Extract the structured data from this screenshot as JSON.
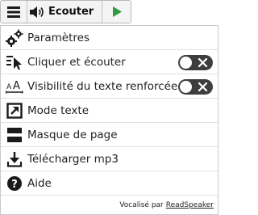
{
  "player": {
    "listen_label": "Ecouter"
  },
  "menu": {
    "items": [
      {
        "label": "Paramètres",
        "icon": "gears-icon"
      },
      {
        "label": "Cliquer et écouter",
        "icon": "click-listen-icon",
        "toggle": "off"
      },
      {
        "label": "Visibilité du texte renforcée",
        "icon": "text-size-icon",
        "toggle": "off"
      },
      {
        "label": "Mode texte",
        "icon": "text-mode-icon"
      },
      {
        "label": "Masque de page",
        "icon": "page-mask-icon"
      },
      {
        "label": "Télécharger mp3",
        "icon": "download-icon"
      },
      {
        "label": "Aide",
        "icon": "help-icon"
      }
    ],
    "footer_prefix": "Vocalisé par",
    "footer_link": "ReadSpeaker"
  },
  "colors": {
    "play_green": "#2e9b3e",
    "toggle_bg": "#3d3d3d",
    "icon_dark": "#1a1a1a"
  }
}
